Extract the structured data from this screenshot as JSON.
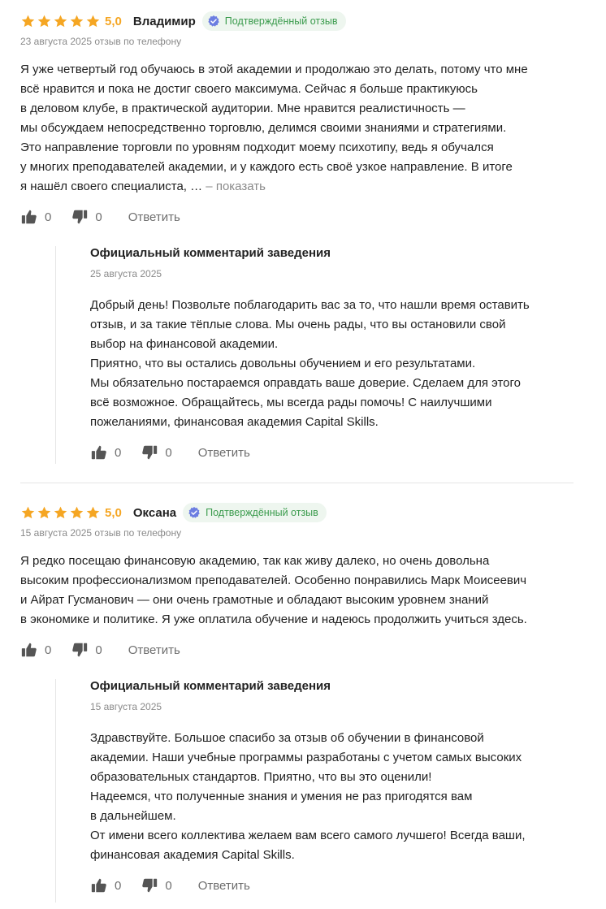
{
  "reviews": [
    {
      "rating": "5,0",
      "stars": 5,
      "author": "Владимир",
      "badge": "Подтверждённый отзыв",
      "meta": "23 августа 2025 отзыв по телефону",
      "text_lines": [
        "Я уже четвертый год обучаюсь в этой академии и продолжаю это делать, потому что мне",
        "всё нравится и пока не достиг своего максимума. Сейчас я больше практикуюсь",
        "в деловом клубе, в практической аудитории. Мне нравится реалистичность —",
        "мы обсуждаем непосредственно торговлю, делимся своими знаниями и стратегиями.",
        "Это направление торговли по уровням подходит моему психотипу, ведь я обучался",
        "у многих преподавателей академии, и у каждого есть своё узкое направление. В итоге",
        "я нашёл своего специалиста, …"
      ],
      "show_more": " – показать",
      "likes": "0",
      "dislikes": "0",
      "reply": "Ответить",
      "official": {
        "title": "Официальный комментарий заведения",
        "date": "25 августа 2025",
        "text_lines": [
          "Добрый день! Позвольте поблагодарить вас за то, что нашли время оставить",
          "отзыв, и за такие тёплые слова. Мы очень рады, что вы остановили свой",
          "выбор на финансовой академии.",
          "Приятно, что вы остались довольны обучением и его результатами.",
          "Мы обязательно постараемся оправдать ваше доверие. Сделаем для этого",
          "всё возможное. Обращайтесь, мы всегда рады помочь! С наилучшими",
          "пожеланиями, финансовая академия Capital Skills."
        ],
        "likes": "0",
        "dislikes": "0",
        "reply": "Ответить"
      }
    },
    {
      "rating": "5,0",
      "stars": 5,
      "author": "Оксана",
      "badge": "Подтверждённый отзыв",
      "meta": "15 августа 2025 отзыв по телефону",
      "text_lines": [
        "Я редко посещаю финансовую академию, так как живу далеко, но очень довольна",
        "высоким профессионализмом преподавателей. Особенно понравились Марк Моисеевич",
        "и Айрат Гусманович — они очень грамотные и обладают высоким уровнем знаний",
        "в экономике и политике. Я уже оплатила обучение и надеюсь продолжить учиться здесь."
      ],
      "likes": "0",
      "dislikes": "0",
      "reply": "Ответить",
      "official": {
        "title": "Официальный комментарий заведения",
        "date": "15 августа 2025",
        "text_lines": [
          "Здравствуйте. Большое спасибо за отзыв об обучении в финансовой",
          "академии. Наши учебные программы разработаны с учетом самых высоких",
          "образовательных стандартов. Приятно, что вы это оценили!",
          "Надеемся, что полученные знания и умения не раз пригодятся вам",
          "в дальнейшем.",
          "От имени всего коллектива желаем вам всего самого лучшего! Всегда ваши,",
          "финансовая академия Capital Skills."
        ],
        "likes": "0",
        "dislikes": "0",
        "reply": "Ответить"
      }
    }
  ],
  "colors": {
    "star": "#f5a623",
    "badge_bg": "#eef6ef",
    "badge_text": "#3a9b4c",
    "badge_icon": "#6c7ee1",
    "muted": "#8a8a8a",
    "action_icon": "#555555"
  },
  "icons": {
    "star": "star-icon",
    "verified": "verified-check-icon",
    "like": "thumbs-up-icon",
    "dislike": "thumbs-down-icon"
  }
}
